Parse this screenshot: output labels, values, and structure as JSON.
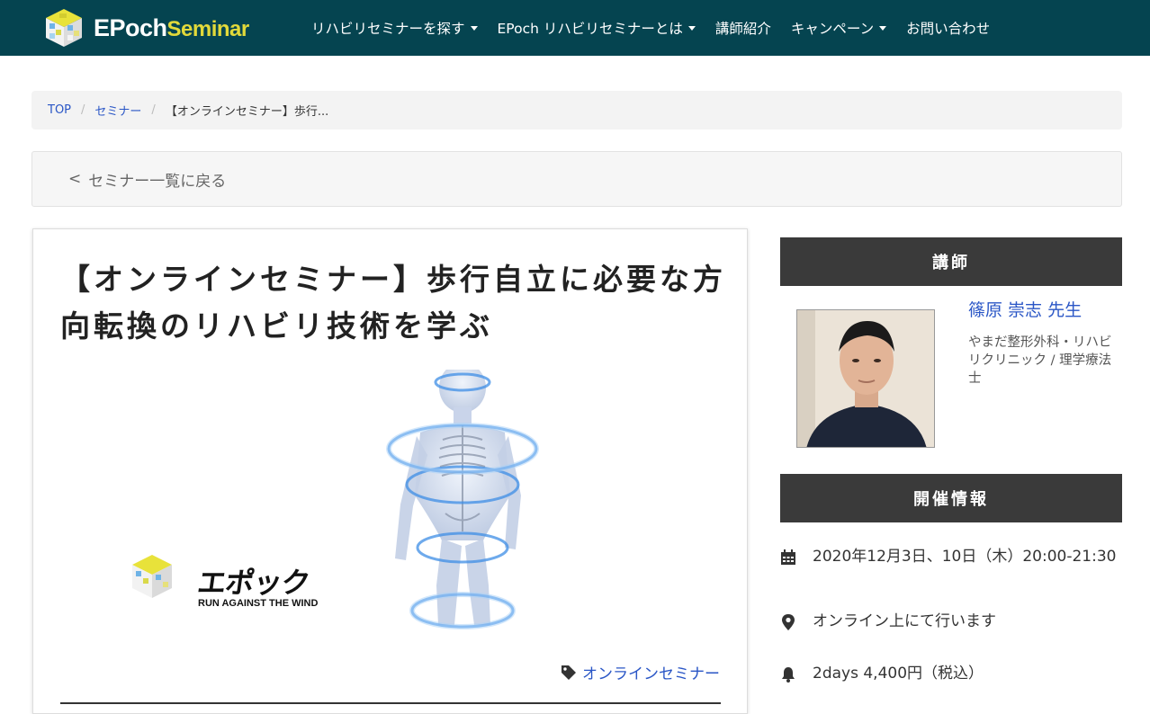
{
  "nav": {
    "logo_main": "EPoch",
    "logo_sub": "Seminar",
    "items": [
      {
        "label": "リハビリセミナーを探す",
        "dropdown": true
      },
      {
        "label": "EPoch リハビリセミナーとは",
        "dropdown": true
      },
      {
        "label": "講師紹介",
        "dropdown": false
      },
      {
        "label": "キャンペーン",
        "dropdown": true
      },
      {
        "label": "お問い合わせ",
        "dropdown": false
      }
    ]
  },
  "breadcrumb": {
    "items": [
      "TOP",
      "セミナー"
    ],
    "current": "【オンラインセミナー】歩行..."
  },
  "back_link": {
    "chevron": "<",
    "label": "セミナー一覧に戻る"
  },
  "seminar": {
    "title": "【オンラインセミナー】歩行自立に必要な方向転換のリハビリ技術を学ぶ",
    "brand_jp": "エポック",
    "brand_en": "RUN AGAINST THE WIND",
    "tag": "オンラインセミナー"
  },
  "sidebar": {
    "lecturer_heading": "講師",
    "lecturer_name": "篠原 崇志 先生",
    "lecturer_affiliation": "やまだ整形外科・リハビリクリニック / 理学療法士",
    "info_heading": "開催情報",
    "date": "2020年12月3日、10日（木）20:00-21:30",
    "location": "オンライン上にて行います",
    "price": "2days 4,400円（税込）"
  },
  "icons": {
    "calendar": "calendar-icon",
    "location": "map-pin-icon",
    "price": "bell-icon",
    "tag": "tag-icon"
  },
  "colors": {
    "nav_bg": "#054450",
    "logo_accent": "#e2d93a",
    "link": "#2a56c6",
    "sidebar_header": "#3a3a3a"
  }
}
